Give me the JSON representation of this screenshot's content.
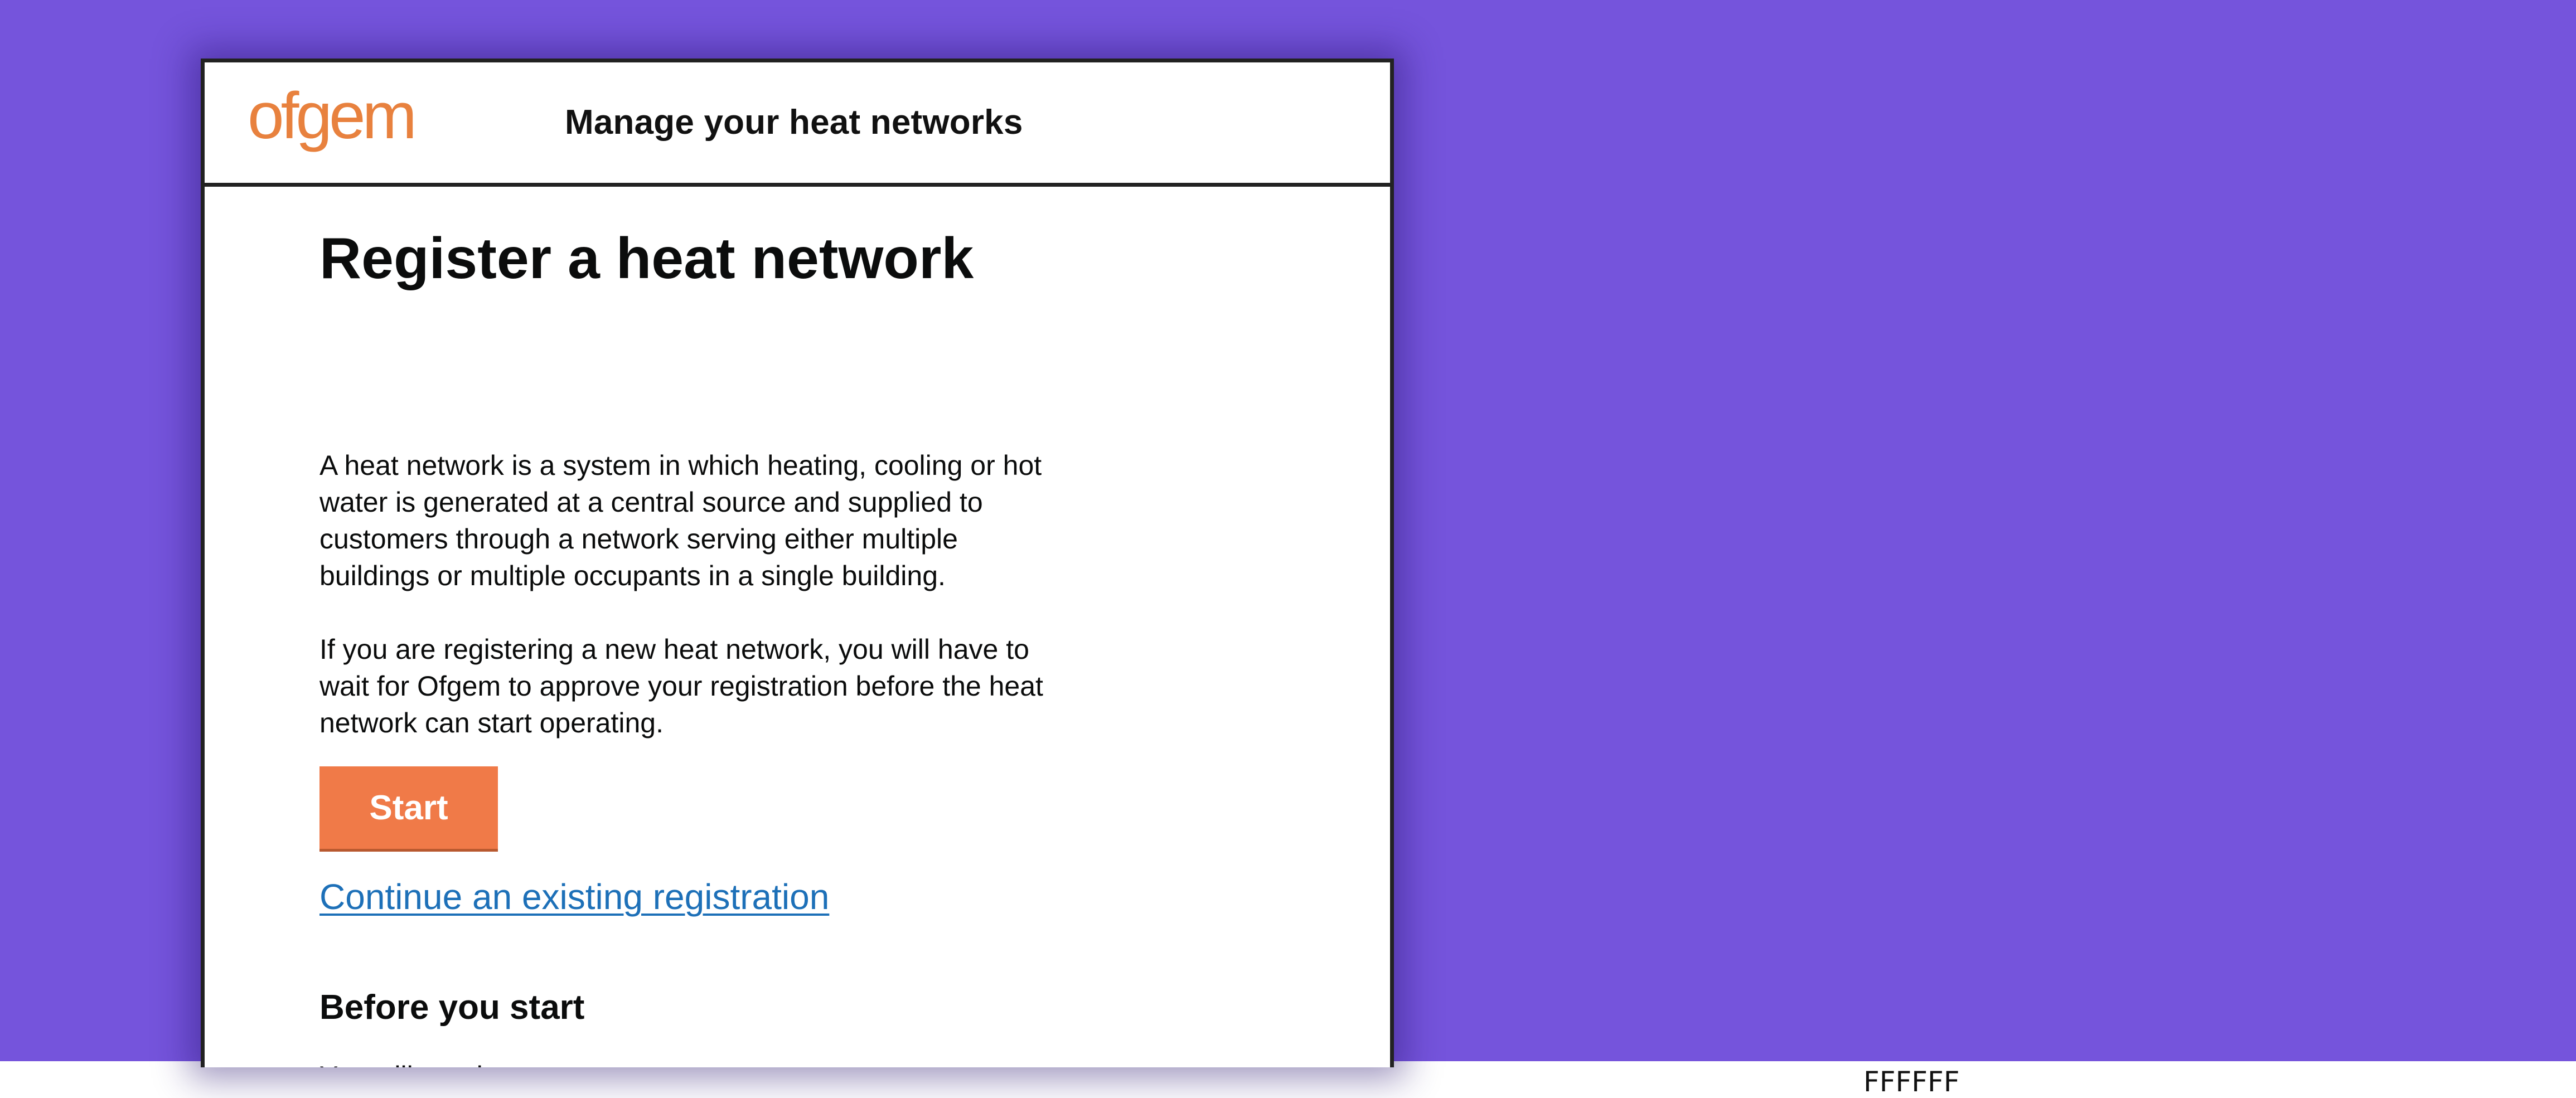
{
  "header": {
    "logo_text": "ofgem",
    "service_name": "Manage your heat networks"
  },
  "main": {
    "title": "Register a heat network",
    "paragraphs": [
      "A heat network is a system in which heating, cooling or hot water is generated at a central source and supplied to customers through a network serving either multiple buildings or multiple occupants in a single building.",
      "If you are registering a new heat network, you will have to wait for Ofgem to approve your registration before the heat network can start operating."
    ],
    "start_button_label": "Start",
    "continue_link_label": "Continue an existing registration",
    "before_heading": "Before you start",
    "need_text": "You will need:"
  },
  "footer_caption": "FFFFFF",
  "colors": {
    "background": "#7554dc",
    "brand_orange": "#f07a48",
    "link_blue": "#1d70b8",
    "text": "#0b0c0c"
  },
  "icons": {
    "logo": "ofgem-logo"
  }
}
